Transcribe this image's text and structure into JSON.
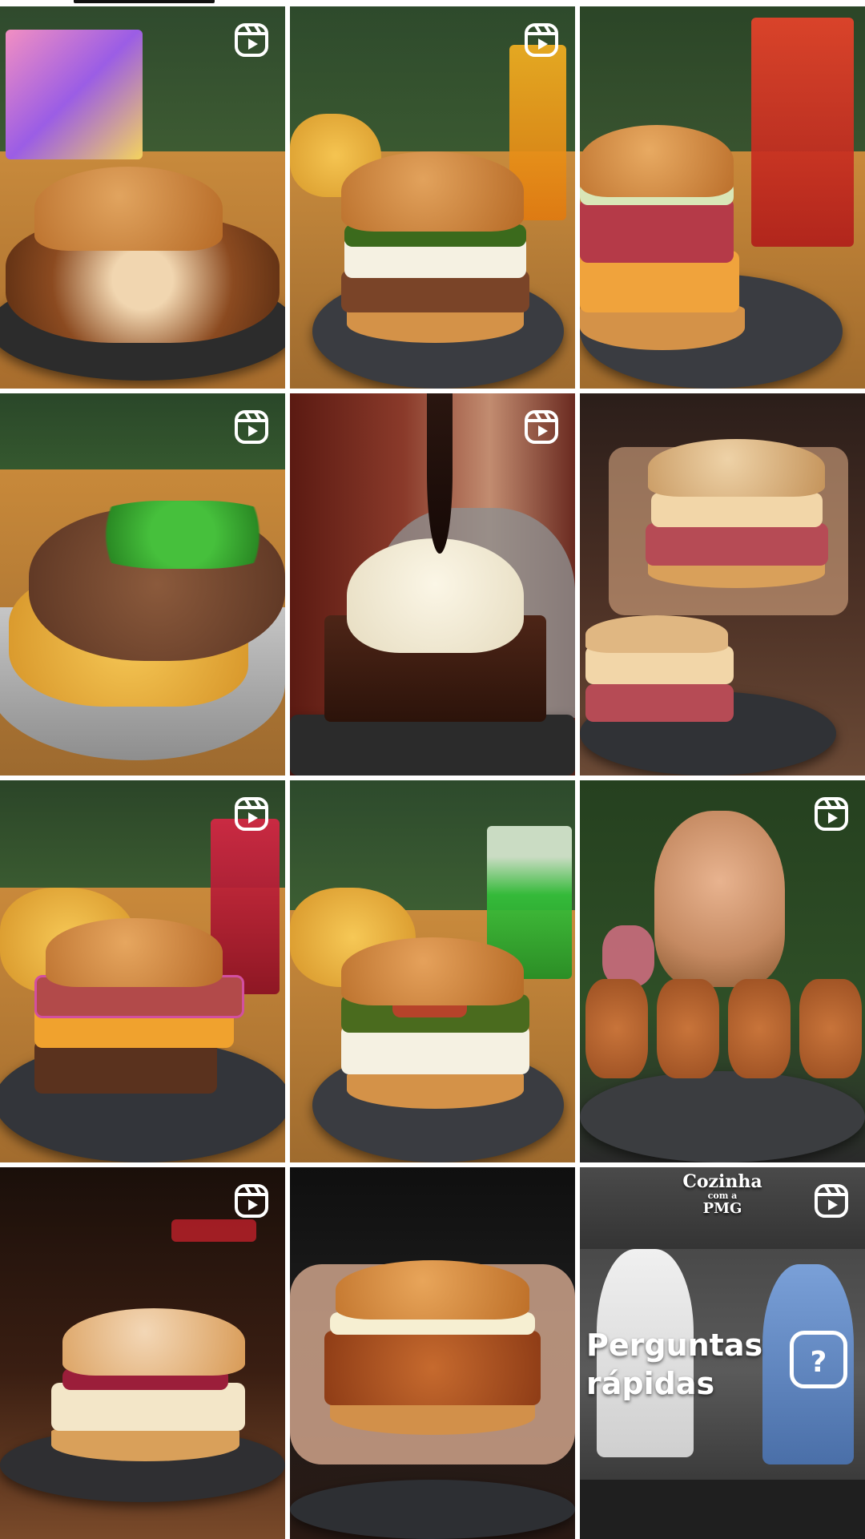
{
  "grid": {
    "columns": 3,
    "rows": 4,
    "tiles": [
      {
        "type": "reel",
        "subject": "burger with crispy toppings and fries box"
      },
      {
        "type": "reel",
        "subject": "burger with pesto and cheese, fries, juice"
      },
      {
        "type": "reel",
        "subject": "pastrami burger with red drink"
      },
      {
        "type": "reel",
        "subject": "loaded fries with pulled meat and scallions"
      },
      {
        "type": "reel",
        "subject": "brownie with ice cream and lime zest"
      },
      {
        "type": "post",
        "subject": "stacked burger held in hands"
      },
      {
        "type": "reel",
        "subject": "bacon burger with red onion, red drink"
      },
      {
        "type": "post",
        "subject": "bacon burger with pesto, green drink"
      },
      {
        "type": "reel",
        "subject": "woman with croquettes topped with cheese"
      },
      {
        "type": "reel",
        "subject": "burger with powdered sugar"
      },
      {
        "type": "post",
        "subject": "fried chicken burger held in hands"
      },
      {
        "type": "reel",
        "subject": "two men in kitchen video"
      }
    ]
  },
  "overlays": {
    "cozinha_logo_line1": "Cozinha",
    "cozinha_logo_line2": "com a",
    "cozinha_logo_line3": "PMG",
    "perguntas_line1": "Perguntas",
    "perguntas_line2": "rápidas",
    "question_mark": "?"
  },
  "icons": {
    "reel": "reels-icon"
  }
}
